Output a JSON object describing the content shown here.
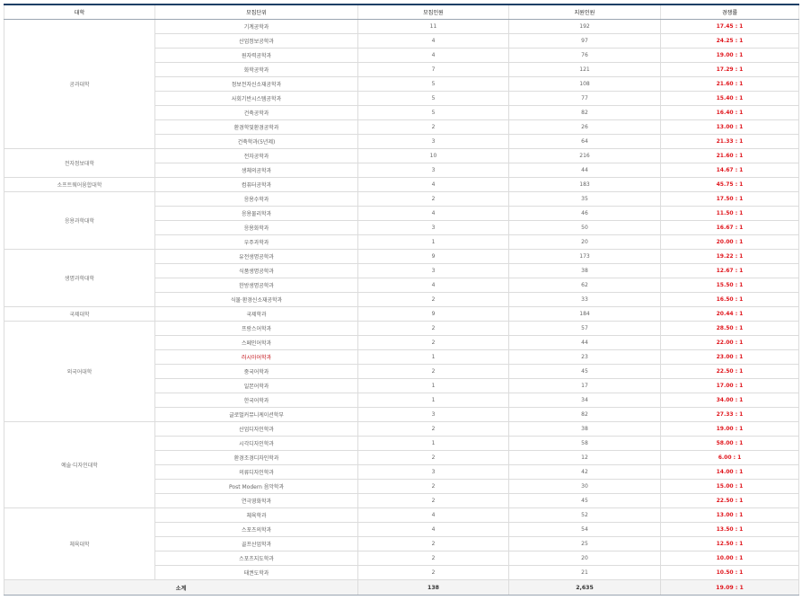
{
  "headers": [
    "대학",
    "모집단위",
    "모집인원",
    "지원인원",
    "경쟁률"
  ],
  "groups": [
    {
      "college": "공과대학",
      "rows": [
        {
          "unit": "기계공학과",
          "quota": "11",
          "applicants": "192",
          "rate": "17.45 : 1"
        },
        {
          "unit": "산업정보공학과",
          "quota": "4",
          "applicants": "97",
          "rate": "24.25 : 1"
        },
        {
          "unit": "원자력공학과",
          "quota": "4",
          "applicants": "76",
          "rate": "19.00 : 1"
        },
        {
          "unit": "화학공학과",
          "quota": "7",
          "applicants": "121",
          "rate": "17.29 : 1"
        },
        {
          "unit": "정보전자신소재공학과",
          "quota": "5",
          "applicants": "108",
          "rate": "21.60 : 1"
        },
        {
          "unit": "사회기반시스템공학과",
          "quota": "5",
          "applicants": "77",
          "rate": "15.40 : 1"
        },
        {
          "unit": "건축공학과",
          "quota": "5",
          "applicants": "82",
          "rate": "16.40 : 1"
        },
        {
          "unit": "환경학및환경공학과",
          "quota": "2",
          "applicants": "26",
          "rate": "13.00 : 1"
        },
        {
          "unit": "건축학과(5년제)",
          "quota": "3",
          "applicants": "64",
          "rate": "21.33 : 1"
        }
      ]
    },
    {
      "college": "전자정보대학",
      "rows": [
        {
          "unit": "전자공학과",
          "quota": "10",
          "applicants": "216",
          "rate": "21.60 : 1"
        },
        {
          "unit": "생체의공학과",
          "quota": "3",
          "applicants": "44",
          "rate": "14.67 : 1"
        }
      ]
    },
    {
      "college": "소프트웨어융합대학",
      "rows": [
        {
          "unit": "컴퓨터공학과",
          "quota": "4",
          "applicants": "183",
          "rate": "45.75 : 1"
        }
      ]
    },
    {
      "college": "응용과학대학",
      "rows": [
        {
          "unit": "응용수학과",
          "quota": "2",
          "applicants": "35",
          "rate": "17.50 : 1"
        },
        {
          "unit": "응용물리학과",
          "quota": "4",
          "applicants": "46",
          "rate": "11.50 : 1"
        },
        {
          "unit": "응용화학과",
          "quota": "3",
          "applicants": "50",
          "rate": "16.67 : 1"
        },
        {
          "unit": "우주과학과",
          "quota": "1",
          "applicants": "20",
          "rate": "20.00 : 1"
        }
      ]
    },
    {
      "college": "생명과학대학",
      "rows": [
        {
          "unit": "유전생명공학과",
          "quota": "9",
          "applicants": "173",
          "rate": "19.22 : 1"
        },
        {
          "unit": "식품생명공학과",
          "quota": "3",
          "applicants": "38",
          "rate": "12.67 : 1"
        },
        {
          "unit": "한방생명공학과",
          "quota": "4",
          "applicants": "62",
          "rate": "15.50 : 1"
        },
        {
          "unit": "식물·환경신소재공학과",
          "quota": "2",
          "applicants": "33",
          "rate": "16.50 : 1"
        }
      ]
    },
    {
      "college": "국제대학",
      "rows": [
        {
          "unit": "국제학과",
          "quota": "9",
          "applicants": "184",
          "rate": "20.44 : 1"
        }
      ]
    },
    {
      "college": "외국어대학",
      "rows": [
        {
          "unit": "프랑스어학과",
          "quota": "2",
          "applicants": "57",
          "rate": "28.50 : 1"
        },
        {
          "unit": "스페인어학과",
          "quota": "2",
          "applicants": "44",
          "rate": "22.00 : 1"
        },
        {
          "unit": "러시아어학과",
          "quota": "1",
          "applicants": "23",
          "rate": "23.00 : 1",
          "highlight": true
        },
        {
          "unit": "중국어학과",
          "quota": "2",
          "applicants": "45",
          "rate": "22.50 : 1"
        },
        {
          "unit": "일본어학과",
          "quota": "1",
          "applicants": "17",
          "rate": "17.00 : 1"
        },
        {
          "unit": "한국어학과",
          "quota": "1",
          "applicants": "34",
          "rate": "34.00 : 1"
        },
        {
          "unit": "글로벌커뮤니케이션학부",
          "quota": "3",
          "applicants": "82",
          "rate": "27.33 : 1"
        }
      ]
    },
    {
      "college": "예술·디자인대학",
      "rows": [
        {
          "unit": "산업디자인학과",
          "quota": "2",
          "applicants": "38",
          "rate": "19.00 : 1"
        },
        {
          "unit": "시각디자인학과",
          "quota": "1",
          "applicants": "58",
          "rate": "58.00 : 1"
        },
        {
          "unit": "환경조경디자인학과",
          "quota": "2",
          "applicants": "12",
          "rate": "6.00 : 1"
        },
        {
          "unit": "의류디자인학과",
          "quota": "3",
          "applicants": "42",
          "rate": "14.00 : 1"
        },
        {
          "unit": "Post Modern 음악학과",
          "quota": "2",
          "applicants": "30",
          "rate": "15.00 : 1"
        },
        {
          "unit": "연극영화학과",
          "quota": "2",
          "applicants": "45",
          "rate": "22.50 : 1"
        }
      ]
    },
    {
      "college": "체육대학",
      "rows": [
        {
          "unit": "체육학과",
          "quota": "4",
          "applicants": "52",
          "rate": "13.00 : 1"
        },
        {
          "unit": "스포츠의학과",
          "quota": "4",
          "applicants": "54",
          "rate": "13.50 : 1"
        },
        {
          "unit": "골프산업학과",
          "quota": "2",
          "applicants": "25",
          "rate": "12.50 : 1"
        },
        {
          "unit": "스포츠지도학과",
          "quota": "2",
          "applicants": "20",
          "rate": "10.00 : 1"
        },
        {
          "unit": "태권도학과",
          "quota": "2",
          "applicants": "21",
          "rate": "10.50 : 1"
        }
      ]
    }
  ],
  "total": {
    "label": "소계",
    "quota": "138",
    "applicants": "2,635",
    "rate": "19.09 : 1"
  },
  "colors": {
    "header_border": "#1d3f66",
    "rate": "#e0161d",
    "total_bg": "#f4f4f4"
  }
}
